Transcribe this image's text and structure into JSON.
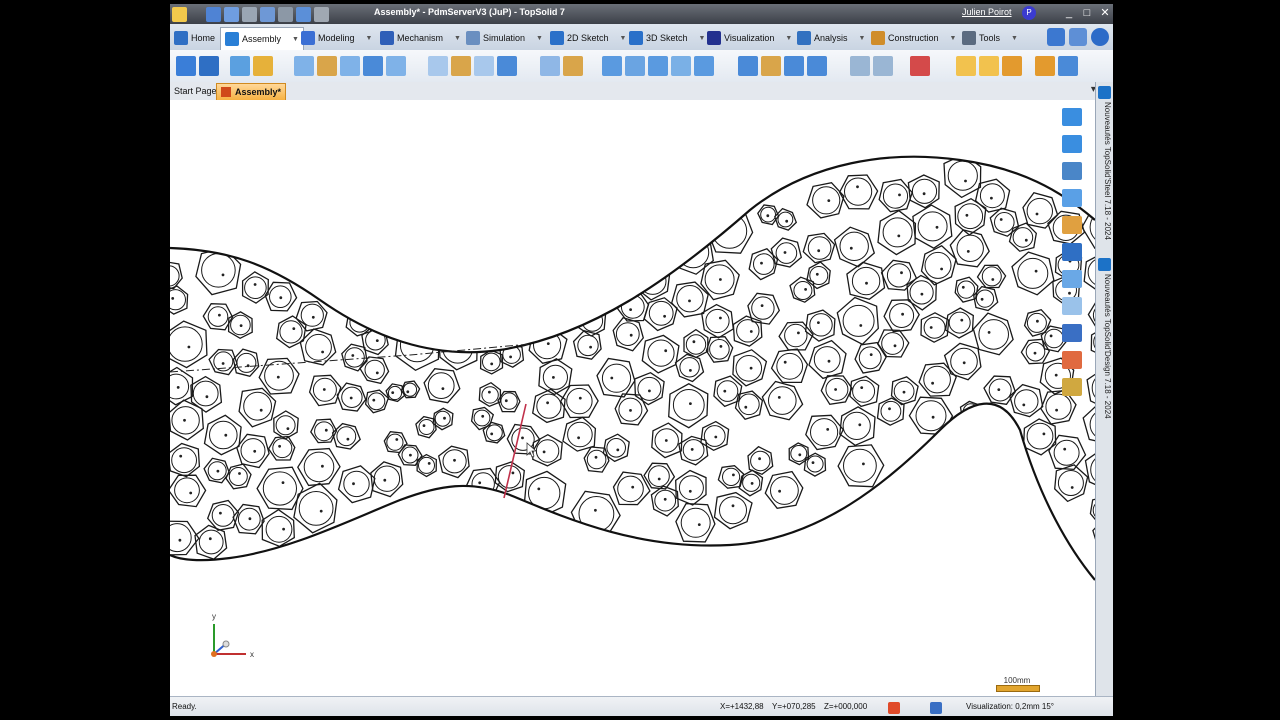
{
  "window": {
    "title": "Assembly* - PdmServerV3 (JuP) - TopSolid 7",
    "user": "Julien Poirot",
    "user_badge": "P",
    "controls": [
      "_",
      "□",
      "✕"
    ]
  },
  "ribbon_tabs": [
    {
      "label": "Home",
      "color": "#2f6fc4"
    },
    {
      "label": "Assembly",
      "color": "#2a7fd6",
      "active": true
    },
    {
      "label": "Modeling",
      "color": "#3b6fd4"
    },
    {
      "label": "Mechanism",
      "color": "#2f5fb8"
    },
    {
      "label": "Simulation",
      "color": "#6a8fc0"
    },
    {
      "label": "2D Sketch",
      "color": "#2a70c9"
    },
    {
      "label": "3D Sketch",
      "color": "#2a70c9"
    },
    {
      "label": "Visualization",
      "color": "#23318f"
    },
    {
      "label": "Analysis",
      "color": "#3271c0"
    },
    {
      "label": "Construction",
      "color": "#d08d2a"
    },
    {
      "label": "Tools",
      "color": "#5b6b80"
    }
  ],
  "document_tabs": {
    "start": "Start Page",
    "active": "Assembly*",
    "controls": "▾ ✕"
  },
  "side_panel": {
    "item1": "Nouveautés TopSolid'Steel 7.18 - 2024",
    "item2": "Nouveautés TopSolid'Design 7.18 - 2024"
  },
  "axis": {
    "x": "x",
    "y": "y"
  },
  "scale": {
    "label": "100mm"
  },
  "status": {
    "ready": "Ready.",
    "x": "X=+1432,88",
    "y": "Y=+070,285",
    "z": "Z=+000,000",
    "visualization": "Visualization: 0,2mm 15°"
  },
  "colors": {
    "accent": "#f7b243",
    "ribbon_bg": "#dfe6ef",
    "title_bg": "#4a4f58",
    "selected_edge": "#c0304a"
  }
}
